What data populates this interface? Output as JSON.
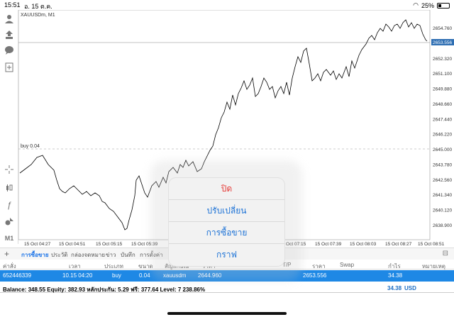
{
  "status": {
    "time": "15:51",
    "date": "อ. 15 ต.ค.",
    "battery": "25%",
    "battery_level": 0.25
  },
  "chart": {
    "symbol_label": "XAUUSDm, M1",
    "position_label": "buy 0.04",
    "current_price": "2653.556",
    "y_ticks": [
      "2654.760",
      "2653.556",
      "2652.320",
      "2651.100",
      "2649.880",
      "2648.660",
      "2647.440",
      "2646.220",
      "2645.000",
      "2643.780",
      "2642.560",
      "2641.340",
      "2640.120",
      "2638.900"
    ],
    "x_ticks": [
      "15 Oct 04:27",
      "15 Oct 04:51",
      "15 Oct 05:15",
      "15 Oct 05:39",
      "15 Oct 07:15",
      "15 Oct 07:39",
      "15 Oct 08:03",
      "15 Oct 08:27",
      "15 Oct 08:51"
    ],
    "line_color": "#000000",
    "price_label_color": "#2f6fb3"
  },
  "tools": [
    "user-icon",
    "trade-icon",
    "chat-icon",
    "add-chart-icon",
    "crosshair-icon",
    "candles-icon",
    "function-icon",
    "objects-icon",
    "timeframe-label"
  ],
  "timeframe": "M1",
  "tabs": [
    "การซื้อขาย",
    "ประวัติ",
    "กล่องจดหมาย",
    "ข่าว",
    "บันทึก",
    "การตั้งค่า"
  ],
  "table": {
    "headers": [
      "ค่าสั่ง",
      "เวลา",
      "ประเภท",
      "ขนาด",
      "สัญลักษณ์",
      "ราคา",
      "S/L",
      "T/P",
      "ราคา",
      "Swap",
      "กำไร",
      "หมายเหตุ"
    ],
    "row": {
      "order": "652446339",
      "time": "10.15 04:20",
      "type": "buy",
      "size": "0.04",
      "symbol": "xauusdm",
      "open_price": "2644.960",
      "price": "2653.556",
      "profit": "34.38"
    }
  },
  "balance": {
    "text": "Balance: 348.55 Equity: 382.93 หลักประกัน: 5.29 ฟรี: 377.64 Level: 7 238.86%",
    "amount": "34.38",
    "currency": "USD"
  },
  "menu": {
    "close": "ปิด",
    "modify": "ปรับเปลี่ยน",
    "trade": "การซื้อขาย",
    "chart": "กราฟ"
  }
}
